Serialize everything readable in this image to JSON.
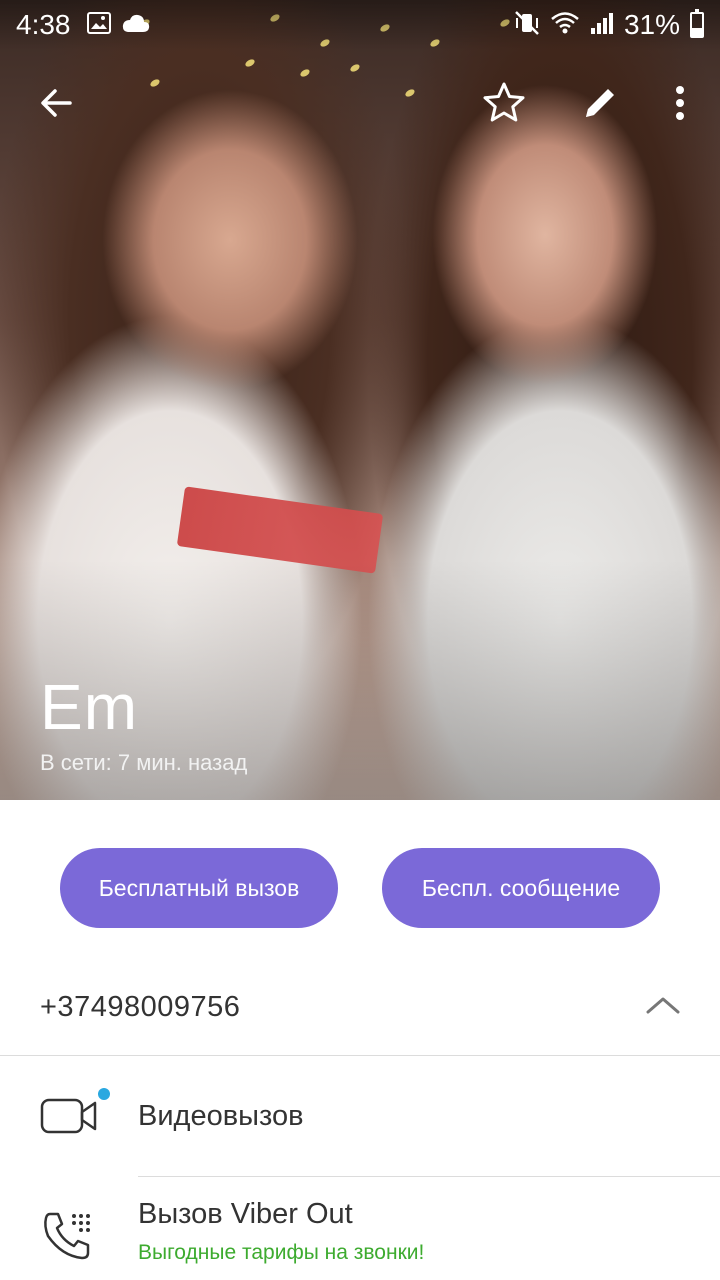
{
  "status_bar": {
    "time": "4:38",
    "battery": "31%",
    "left_icons": [
      "image-icon",
      "cloud-icon"
    ],
    "right_icons": [
      "mute-vibrate-icon",
      "wifi-icon",
      "signal-icon",
      "battery-icon"
    ]
  },
  "toolbar": {
    "icons": [
      "back-arrow-icon",
      "star-icon",
      "edit-pencil-icon",
      "more-vert-icon"
    ]
  },
  "contact": {
    "name": "Em",
    "status": "В сети: 7 мин. назад"
  },
  "actions": {
    "free_call": "Бесплатный вызов",
    "free_message": "Беспл. сообщение",
    "accent_color": "#7b69d8"
  },
  "phone": {
    "number": "+37498009756"
  },
  "items": {
    "video_call": {
      "title": "Видеовызов"
    },
    "viber_out": {
      "title": "Вызов Viber Out",
      "subtitle": "Выгодные тарифы на звонки!",
      "subtitle_color": "#3dab2f"
    }
  }
}
